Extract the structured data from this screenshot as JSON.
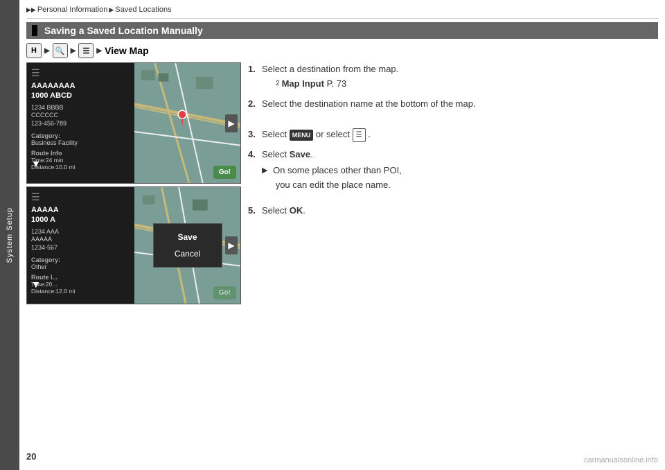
{
  "sidebar": {
    "label": "System Setup"
  },
  "breadcrumb": {
    "items": [
      "Personal Information",
      "Saved Locations"
    ]
  },
  "section": {
    "title": "Saving a Saved Location Manually"
  },
  "nav": {
    "icons": [
      "H",
      "🔍",
      "▶",
      "☰",
      "▶"
    ],
    "view_map": "View Map"
  },
  "screen_top": {
    "title": "AAAAAAAA\n1000 ABCD",
    "address": "1234 BBBB\nCCCCCC\n123-456-789",
    "category_label": "Category:",
    "category_value": "Business Facility",
    "route_label": "Route Info",
    "route_value": "Time:24 min\nDistance:10.0 mi"
  },
  "screen_bottom": {
    "title": "AAAAA\n1000 A",
    "address": "1234 AAA\nAAAAA\n1234-567",
    "category_label": "Category:",
    "category_value": "Other",
    "route_label": "Route I...",
    "route_value": "Time:20...\nDistance:12.0 mi"
  },
  "overlay": {
    "save_label": "Save",
    "cancel_label": "Cancel"
  },
  "go_button": "Go!",
  "instructions": [
    {
      "number": "1.",
      "text": "Select a destination from the map.",
      "sub": "2 Map Input P. 73"
    },
    {
      "number": "2.",
      "text": "Select the destination name at the bottom of the map."
    },
    {
      "number": "3.",
      "text": "Select",
      "text2": "or select",
      "badge1": "MENU",
      "badge2": "☰"
    },
    {
      "number": "4.",
      "text": "Select",
      "bold": "Save",
      "sub": "On some places other than POI, you can edit the place name."
    },
    {
      "number": "5.",
      "text": "Select",
      "bold": "OK."
    }
  ],
  "page_number": "20",
  "watermark": "carmanualsonline.info"
}
